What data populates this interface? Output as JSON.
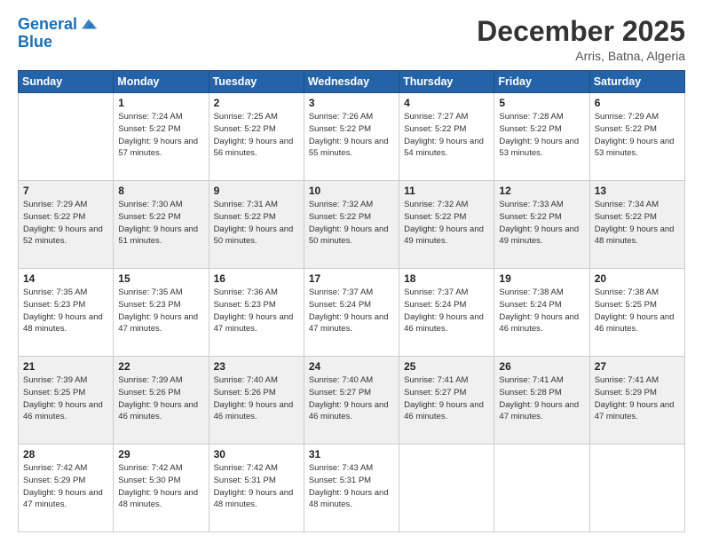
{
  "logo": {
    "line1": "General",
    "line2": "Blue"
  },
  "title": "December 2025",
  "location": "Arris, Batna, Algeria",
  "days_of_week": [
    "Sunday",
    "Monday",
    "Tuesday",
    "Wednesday",
    "Thursday",
    "Friday",
    "Saturday"
  ],
  "weeks": [
    [
      {
        "day": "",
        "sunrise": "",
        "sunset": "",
        "daylight": ""
      },
      {
        "day": "1",
        "sunrise": "Sunrise: 7:24 AM",
        "sunset": "Sunset: 5:22 PM",
        "daylight": "Daylight: 9 hours and 57 minutes."
      },
      {
        "day": "2",
        "sunrise": "Sunrise: 7:25 AM",
        "sunset": "Sunset: 5:22 PM",
        "daylight": "Daylight: 9 hours and 56 minutes."
      },
      {
        "day": "3",
        "sunrise": "Sunrise: 7:26 AM",
        "sunset": "Sunset: 5:22 PM",
        "daylight": "Daylight: 9 hours and 55 minutes."
      },
      {
        "day": "4",
        "sunrise": "Sunrise: 7:27 AM",
        "sunset": "Sunset: 5:22 PM",
        "daylight": "Daylight: 9 hours and 54 minutes."
      },
      {
        "day": "5",
        "sunrise": "Sunrise: 7:28 AM",
        "sunset": "Sunset: 5:22 PM",
        "daylight": "Daylight: 9 hours and 53 minutes."
      },
      {
        "day": "6",
        "sunrise": "Sunrise: 7:29 AM",
        "sunset": "Sunset: 5:22 PM",
        "daylight": "Daylight: 9 hours and 53 minutes."
      }
    ],
    [
      {
        "day": "7",
        "sunrise": "Sunrise: 7:29 AM",
        "sunset": "Sunset: 5:22 PM",
        "daylight": "Daylight: 9 hours and 52 minutes."
      },
      {
        "day": "8",
        "sunrise": "Sunrise: 7:30 AM",
        "sunset": "Sunset: 5:22 PM",
        "daylight": "Daylight: 9 hours and 51 minutes."
      },
      {
        "day": "9",
        "sunrise": "Sunrise: 7:31 AM",
        "sunset": "Sunset: 5:22 PM",
        "daylight": "Daylight: 9 hours and 50 minutes."
      },
      {
        "day": "10",
        "sunrise": "Sunrise: 7:32 AM",
        "sunset": "Sunset: 5:22 PM",
        "daylight": "Daylight: 9 hours and 50 minutes."
      },
      {
        "day": "11",
        "sunrise": "Sunrise: 7:32 AM",
        "sunset": "Sunset: 5:22 PM",
        "daylight": "Daylight: 9 hours and 49 minutes."
      },
      {
        "day": "12",
        "sunrise": "Sunrise: 7:33 AM",
        "sunset": "Sunset: 5:22 PM",
        "daylight": "Daylight: 9 hours and 49 minutes."
      },
      {
        "day": "13",
        "sunrise": "Sunrise: 7:34 AM",
        "sunset": "Sunset: 5:22 PM",
        "daylight": "Daylight: 9 hours and 48 minutes."
      }
    ],
    [
      {
        "day": "14",
        "sunrise": "Sunrise: 7:35 AM",
        "sunset": "Sunset: 5:23 PM",
        "daylight": "Daylight: 9 hours and 48 minutes."
      },
      {
        "day": "15",
        "sunrise": "Sunrise: 7:35 AM",
        "sunset": "Sunset: 5:23 PM",
        "daylight": "Daylight: 9 hours and 47 minutes."
      },
      {
        "day": "16",
        "sunrise": "Sunrise: 7:36 AM",
        "sunset": "Sunset: 5:23 PM",
        "daylight": "Daylight: 9 hours and 47 minutes."
      },
      {
        "day": "17",
        "sunrise": "Sunrise: 7:37 AM",
        "sunset": "Sunset: 5:24 PM",
        "daylight": "Daylight: 9 hours and 47 minutes."
      },
      {
        "day": "18",
        "sunrise": "Sunrise: 7:37 AM",
        "sunset": "Sunset: 5:24 PM",
        "daylight": "Daylight: 9 hours and 46 minutes."
      },
      {
        "day": "19",
        "sunrise": "Sunrise: 7:38 AM",
        "sunset": "Sunset: 5:24 PM",
        "daylight": "Daylight: 9 hours and 46 minutes."
      },
      {
        "day": "20",
        "sunrise": "Sunrise: 7:38 AM",
        "sunset": "Sunset: 5:25 PM",
        "daylight": "Daylight: 9 hours and 46 minutes."
      }
    ],
    [
      {
        "day": "21",
        "sunrise": "Sunrise: 7:39 AM",
        "sunset": "Sunset: 5:25 PM",
        "daylight": "Daylight: 9 hours and 46 minutes."
      },
      {
        "day": "22",
        "sunrise": "Sunrise: 7:39 AM",
        "sunset": "Sunset: 5:26 PM",
        "daylight": "Daylight: 9 hours and 46 minutes."
      },
      {
        "day": "23",
        "sunrise": "Sunrise: 7:40 AM",
        "sunset": "Sunset: 5:26 PM",
        "daylight": "Daylight: 9 hours and 46 minutes."
      },
      {
        "day": "24",
        "sunrise": "Sunrise: 7:40 AM",
        "sunset": "Sunset: 5:27 PM",
        "daylight": "Daylight: 9 hours and 46 minutes."
      },
      {
        "day": "25",
        "sunrise": "Sunrise: 7:41 AM",
        "sunset": "Sunset: 5:27 PM",
        "daylight": "Daylight: 9 hours and 46 minutes."
      },
      {
        "day": "26",
        "sunrise": "Sunrise: 7:41 AM",
        "sunset": "Sunset: 5:28 PM",
        "daylight": "Daylight: 9 hours and 47 minutes."
      },
      {
        "day": "27",
        "sunrise": "Sunrise: 7:41 AM",
        "sunset": "Sunset: 5:29 PM",
        "daylight": "Daylight: 9 hours and 47 minutes."
      }
    ],
    [
      {
        "day": "28",
        "sunrise": "Sunrise: 7:42 AM",
        "sunset": "Sunset: 5:29 PM",
        "daylight": "Daylight: 9 hours and 47 minutes."
      },
      {
        "day": "29",
        "sunrise": "Sunrise: 7:42 AM",
        "sunset": "Sunset: 5:30 PM",
        "daylight": "Daylight: 9 hours and 48 minutes."
      },
      {
        "day": "30",
        "sunrise": "Sunrise: 7:42 AM",
        "sunset": "Sunset: 5:31 PM",
        "daylight": "Daylight: 9 hours and 48 minutes."
      },
      {
        "day": "31",
        "sunrise": "Sunrise: 7:43 AM",
        "sunset": "Sunset: 5:31 PM",
        "daylight": "Daylight: 9 hours and 48 minutes."
      },
      {
        "day": "",
        "sunrise": "",
        "sunset": "",
        "daylight": ""
      },
      {
        "day": "",
        "sunrise": "",
        "sunset": "",
        "daylight": ""
      },
      {
        "day": "",
        "sunrise": "",
        "sunset": "",
        "daylight": ""
      }
    ]
  ],
  "row_shading": [
    false,
    true,
    false,
    true,
    false
  ]
}
